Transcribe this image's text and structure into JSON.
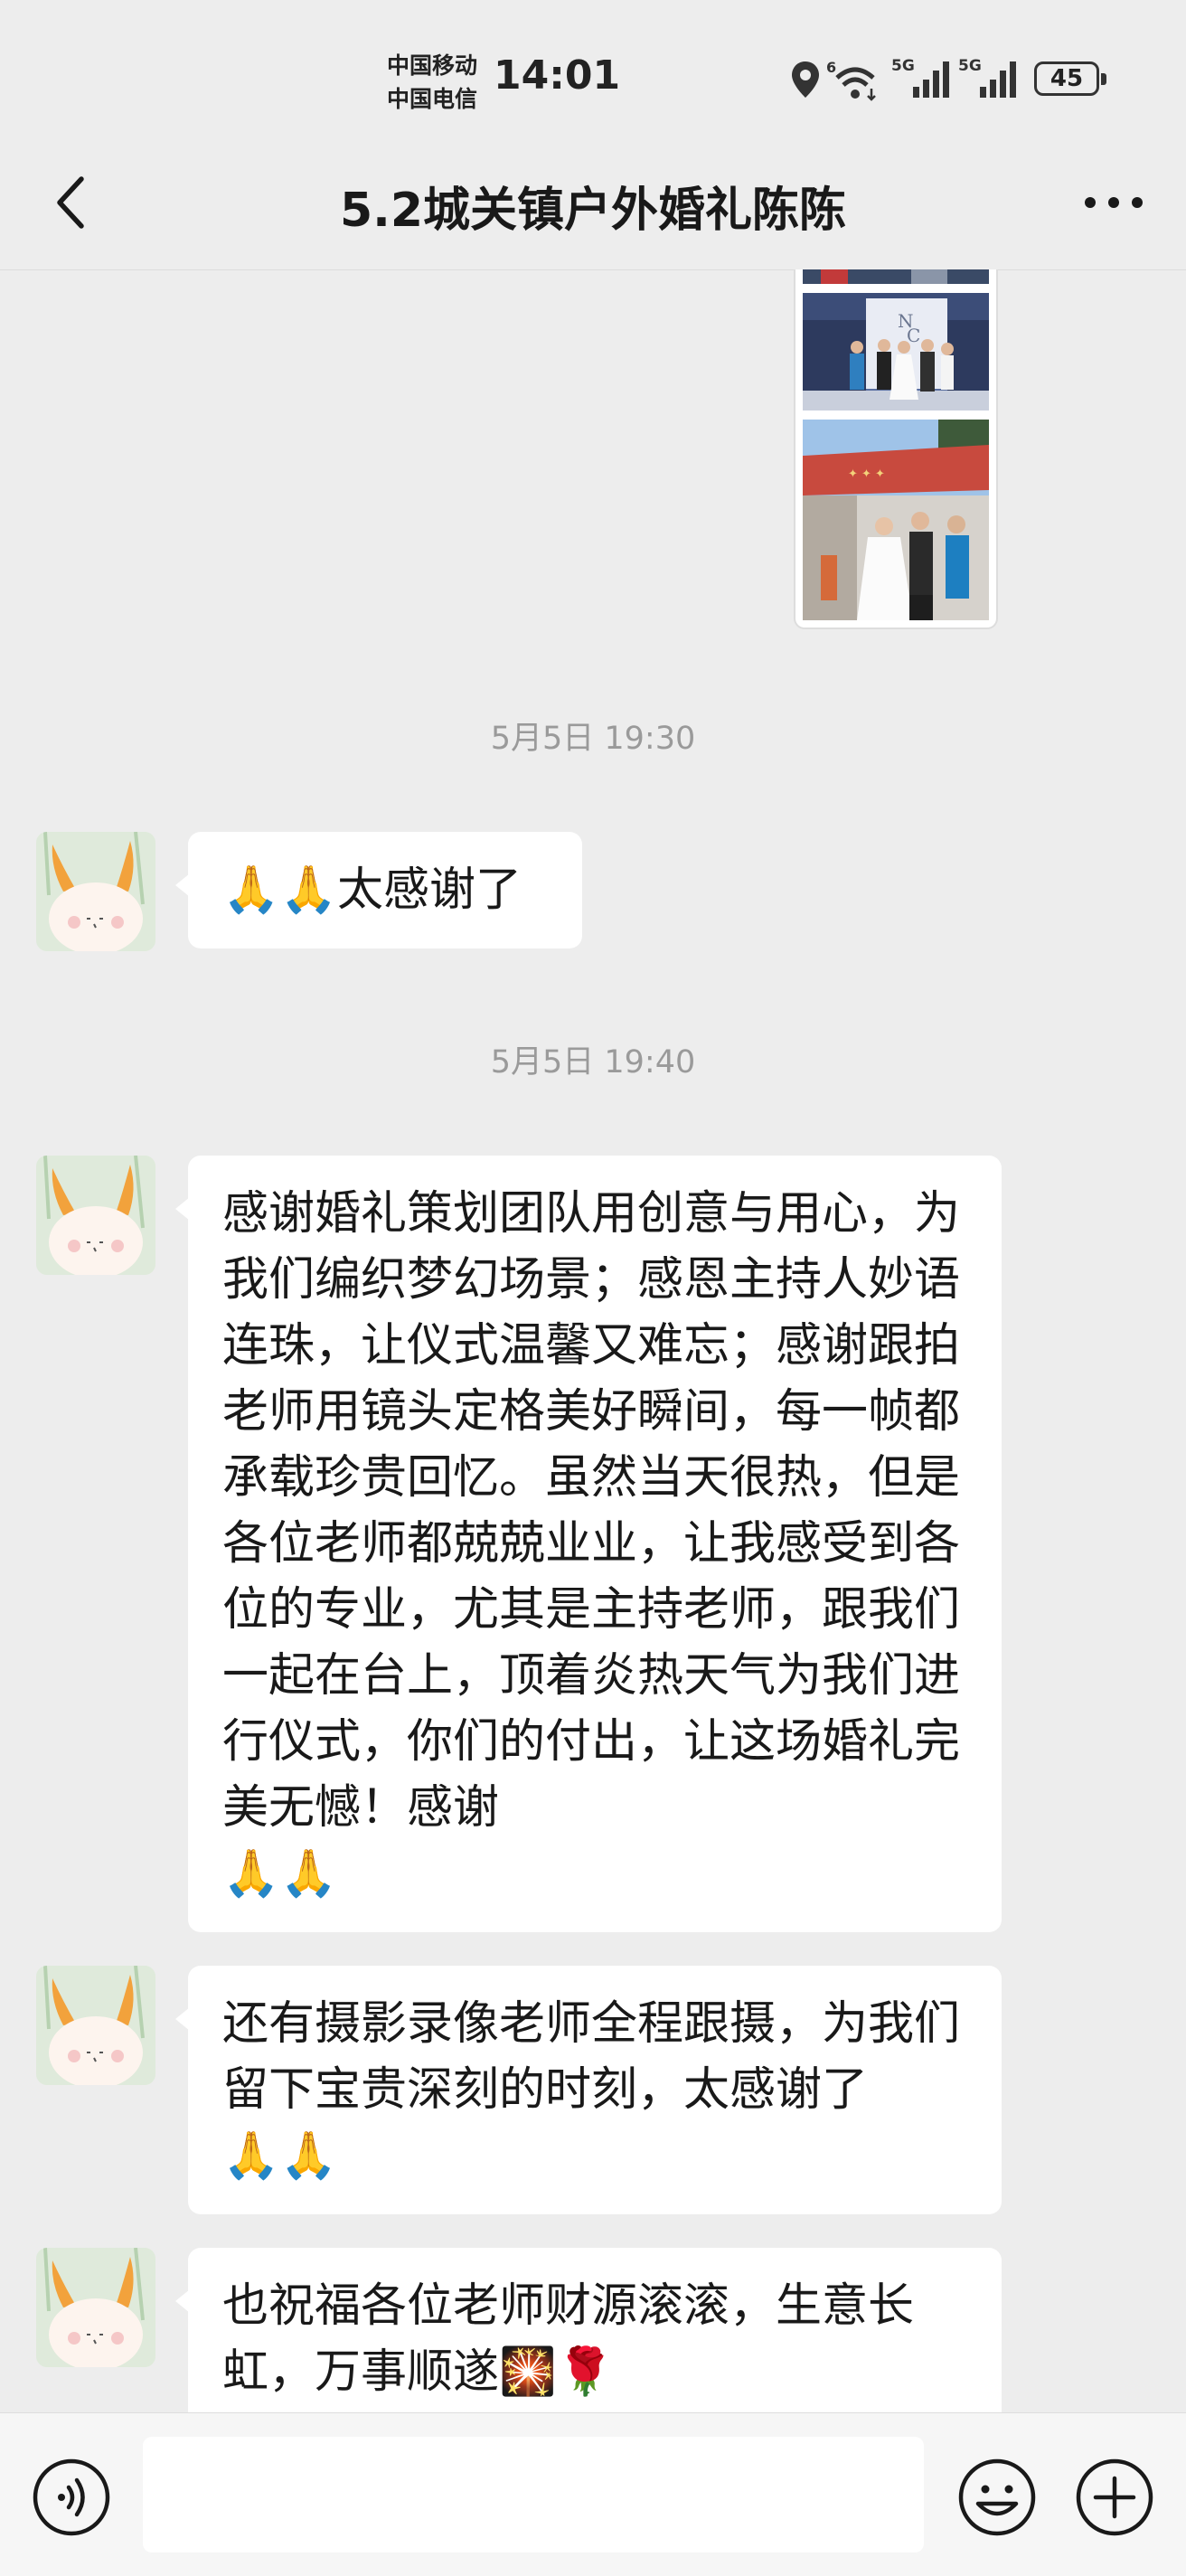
{
  "status_bar": {
    "carrier_1": "中国移动",
    "carrier_2": "中国电信",
    "time": "14:01",
    "wifi_badge": "6",
    "signal_1": "5G",
    "signal_2": "5G",
    "battery": "45"
  },
  "header": {
    "title": "5.2城关镇户外婚礼陈陈"
  },
  "messages": [
    {
      "type": "timestamp",
      "text": "5月5日 19:30"
    },
    {
      "type": "text",
      "emoji": "🙏🙏",
      "text": "太感谢了"
    },
    {
      "type": "timestamp",
      "text": "5月5日 19:40"
    },
    {
      "type": "text",
      "text": "感谢婚礼策划团队用创意与用心，为我们编织梦幻场景；感恩主持人妙语连珠，让仪式温馨又难忘；感谢跟拍老师用镜头定格美好瞬间，每一帧都承载珍贵回忆。虽然当天很热，但是各位老师都兢兢业业，让我感受到各位的专业，尤其是主持老师，跟我们一起在台上，顶着炎热天气为我们进行仪式，你们的付出，让这场婚礼完美无憾！感谢",
      "emoji_after": "🙏🙏"
    },
    {
      "type": "text",
      "text": "还有摄影录像老师全程跟摄，为我们留下宝贵深刻的时刻，太感谢了",
      "emoji_after": "🙏🙏"
    },
    {
      "type": "text",
      "text": "也祝福各位老师财源滚滚，生意长虹，万事顺遂",
      "emoji_after": "🎇🌹"
    }
  ],
  "input": {
    "placeholder": ""
  },
  "icons": {
    "back": "chevron-left-icon",
    "more": "more-dots-icon",
    "voice": "voice-icon",
    "emoji": "emoji-face-icon",
    "plus": "plus-icon"
  },
  "colors": {
    "background": "#ededed",
    "bubble": "#ffffff",
    "timestamp": "#9a9a9a"
  }
}
